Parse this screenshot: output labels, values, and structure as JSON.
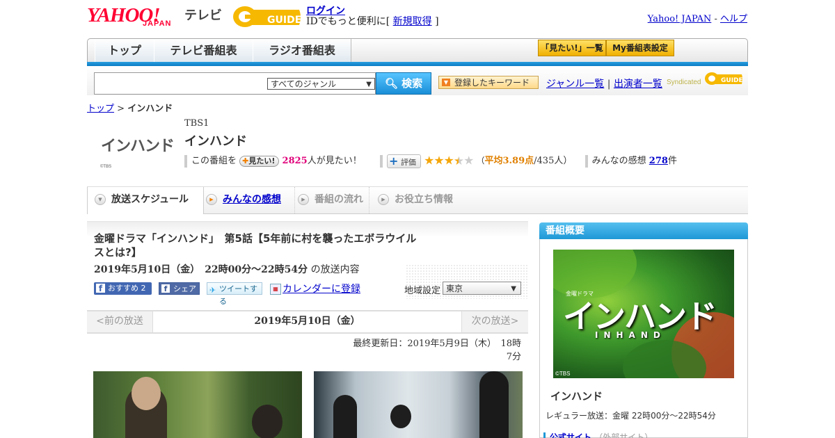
{
  "header": {
    "logo_yahoo": "YAHOO!",
    "logo_japan": "JAPAN",
    "logo_tv": "テレビ",
    "logo_gguide": "GUIDE",
    "login": "ログイン",
    "login_sub_prefix": "IDでもっと便利に[",
    "signup": "新規取得",
    "login_sub_suffix": "]",
    "yahoo_japan_link": "Yahoo! JAPAN",
    "separator": "-",
    "help_link": "ヘルプ"
  },
  "nav": {
    "tabs": [
      "トップ",
      "テレビ番組表",
      "ラジオ番組表"
    ],
    "wishlist_button": "「見たい!」一覧",
    "my_schedule_button": "My番組表設定"
  },
  "search": {
    "input_value": "",
    "genre_selected": "すべてのジャンル",
    "button": "検索",
    "keyword_button": "登録したキーワード",
    "genre_list": "ジャンル一覧",
    "divider": "|",
    "cast_list": "出演者一覧",
    "syndicated": "Syndicated"
  },
  "breadcrumb": {
    "top": "トップ",
    "sep": ">",
    "current": "インハンド"
  },
  "program": {
    "logo_text": "インハンド",
    "logo_copyright": "©TBS",
    "channel": "TBS1",
    "title": "インハンド",
    "want_prefix": "この番組を",
    "want_pill": "見たい!",
    "want_count": "2825",
    "want_suffix": "人が見たい！",
    "eval_pill": "評価",
    "rating_stars": 3.89,
    "rating_open": "（",
    "rating_avg": "平均3.89点",
    "rating_count": "/435人）",
    "impressions_prefix": "みんなの感想",
    "impressions_count": "278",
    "impressions_suffix": "件"
  },
  "tabs": {
    "schedule": "放送スケジュール",
    "impressions": "みんなの感想",
    "flow": "番組の流れ",
    "info": "お役立ち情報"
  },
  "episode": {
    "title": "金曜ドラマ「インハンド」　第5話【5年前に村を襲ったエボラウイルスとは?】",
    "date_time": "2019年5月10日（金）　22時00分～22時54分",
    "date_suffix": "の放送内容",
    "fb_recommend": "おすすめ",
    "fb_recommend_count": "2",
    "fb_share": "シェア",
    "tweet": "ツイートする",
    "calendar": "カレンダーに登録",
    "region_label": "地域設定",
    "region_value": "東京"
  },
  "datenav": {
    "prev": "<前の放送",
    "current": "2019年5月10日（金）",
    "next": "次の放送>",
    "updated": "最終更新日：2019年5月9日（木）　18時7分"
  },
  "sidebar": {
    "header": "番組概要",
    "poster_subtitle": "金曜ドラマ",
    "poster_title": "インハンド",
    "poster_english": "INHAND",
    "poster_copyright": "©TBS",
    "title": "インハンド",
    "regular": "レギュラー放送：金曜 22時00分～22時54分",
    "official_site": "公式サイト",
    "external": "（外部サイト）"
  },
  "colors": {
    "accent_blue": "#1e98d6",
    "link": "#0000cc",
    "want_pink": "#e0007a",
    "rating_orange": "#e08000",
    "yahoo_red": "#ff0033"
  }
}
